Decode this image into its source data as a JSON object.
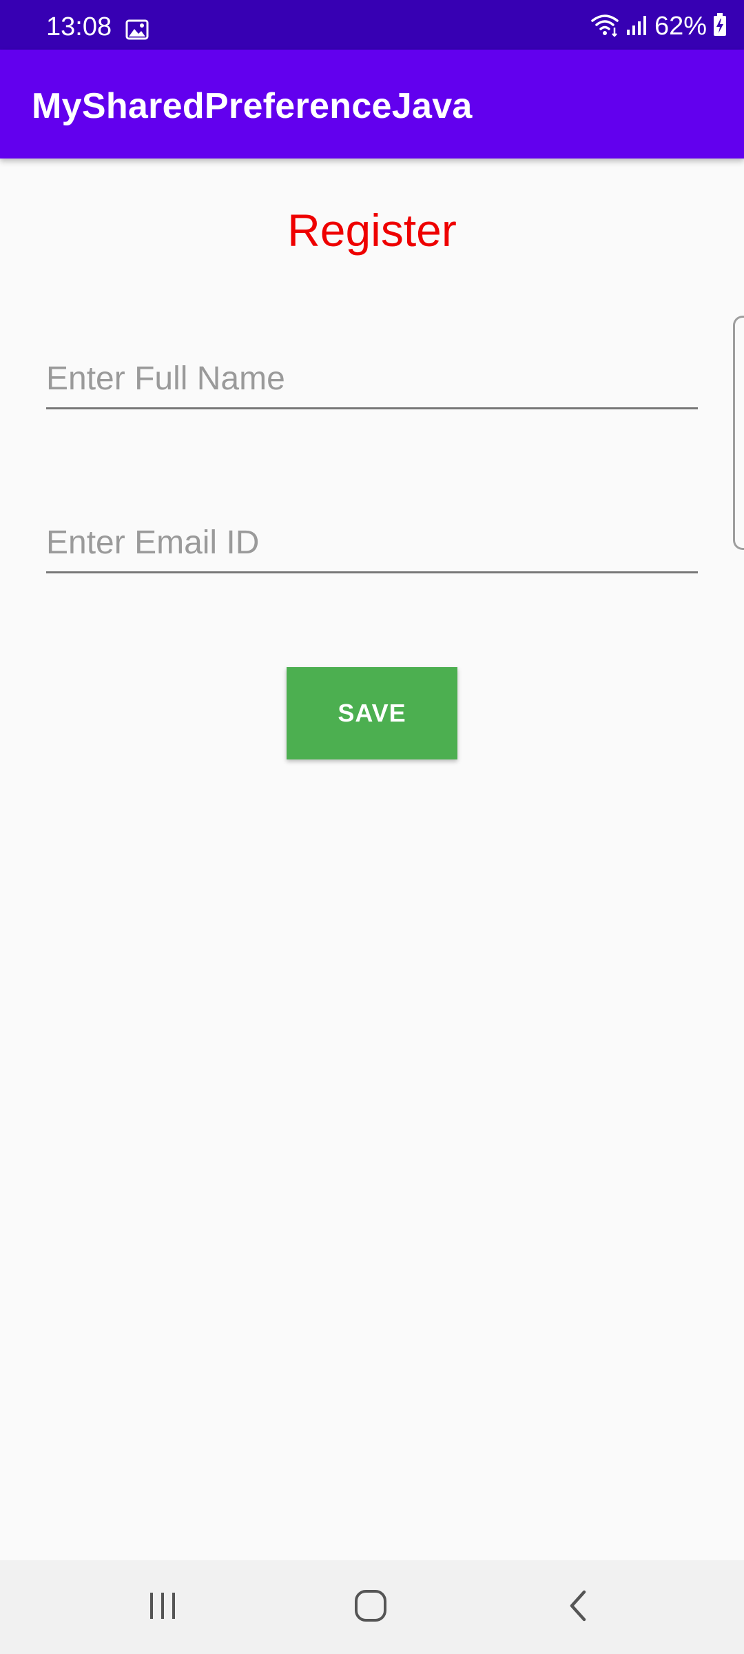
{
  "status_bar": {
    "time": "13:08",
    "battery_text": "62%",
    "icons": [
      "image-icon",
      "wifi-icon",
      "signal-icon",
      "battery-charging-icon"
    ]
  },
  "app_bar": {
    "title": "MySharedPreferenceJava"
  },
  "form": {
    "heading": "Register",
    "full_name_placeholder": "Enter Full Name",
    "full_name_value": "",
    "email_placeholder": "Enter Email ID",
    "email_value": "",
    "save_label": "SAVE"
  },
  "nav_bar": {
    "icons": [
      "recents-icon",
      "home-icon",
      "back-icon"
    ]
  },
  "colors": {
    "status_bar": "#3700b3",
    "app_bar": "#6200ee",
    "heading": "#ee0000",
    "save_button": "#4caf50",
    "background": "#fafafa"
  }
}
